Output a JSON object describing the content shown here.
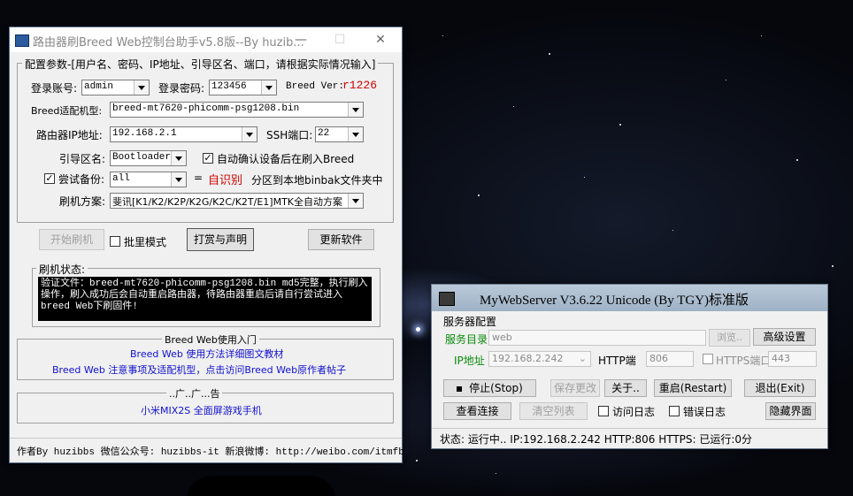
{
  "win1": {
    "title": "路由器刷Breed Web控制台助手v5.8版--By huzib...",
    "config_group_label": "配置参数-[用户名、密码、IP地址、引导区名、端口，请根据实际情况输入]",
    "login_account_label": "登录账号:",
    "login_account_value": "admin",
    "login_password_label": "登录密码:",
    "login_password_value": "123456",
    "breed_ver_label": "Breed Ver:",
    "breed_ver_value": "r1226",
    "model_label": "Breed适配机型:",
    "model_value": "breed-mt7620-phicomm-psg1208.bin",
    "ip_label": "路由器IP地址:",
    "ip_value": "192.168.2.1",
    "ssh_label": "SSH端口:",
    "ssh_value": "22",
    "boot_label": "引导区名:",
    "boot_value": "Bootloader",
    "auto_confirm_label": "自动确认设备后在刷入Breed",
    "auto_confirm_checked": true,
    "backup_label": "尝试备份:",
    "backup_checked": true,
    "backup_value": "all",
    "backup_eq": "=",
    "backup_auto": "自识别",
    "backup_note": "分区到本地binbak文件夹中",
    "scheme_label": "刷机方案:",
    "scheme_value": "斐讯[K1/K2/K2P/K2G/K2C/K2T/E1]MTK全自动方案",
    "start_button": "开始刷机",
    "batch_label": "批里模式",
    "batch_checked": false,
    "donate_button": "打赏与声明",
    "update_button": "更新软件",
    "status_group_label": "刷机状态:",
    "status_text": "验证文件：breed-mt7620-phicomm-psg1208.bin md5完整，执行刷入操作，刷入成功后会自动重启路由器，待路由器重启后请自行尝试进入breed Web下刷固件!",
    "guide_group_label": "Breed Web使用入门",
    "guide_link1": "Breed Web 使用方法详细图文教材",
    "guide_link2": "Breed Web 注意事项及适配机型，点击访问Breed Web原作者帖子",
    "ad_group_label": "..广..广...告",
    "ad_link": "小米MIX2S 全面屏游戏手机",
    "footer": "作者By huzibbs 微信公众号: huzibbs-it 新浪微博: http://weibo.com/itmfb"
  },
  "win2": {
    "title": "MyWebServer V3.6.22 Unicode (By TGY)标准版",
    "server_config_label": "服务器配置",
    "dir_label": "服务目录",
    "dir_value": "web",
    "browse_button": "浏览..",
    "advanced_button": "高级设置",
    "ip_label": "IP地址",
    "ip_value": "192.168.2.242",
    "http_label": "HTTP端",
    "http_value": "806",
    "https_label": "HTTPS端口",
    "https_value": "443",
    "stop_button": "停止(Stop)",
    "save_button": "保存更改",
    "about_button": "关于..",
    "restart_button": "重启(Restart)",
    "exit_button": "退出(Exit)",
    "view_conn_button": "查看连接",
    "clear_list_button": "清空列表",
    "access_log_label": "访问日志",
    "error_log_label": "错误日志",
    "hide_button": "隐藏界面",
    "status": "状态: 运行中.. IP:192.168.2.242 HTTP:806 HTTPS: 已运行:0分"
  }
}
